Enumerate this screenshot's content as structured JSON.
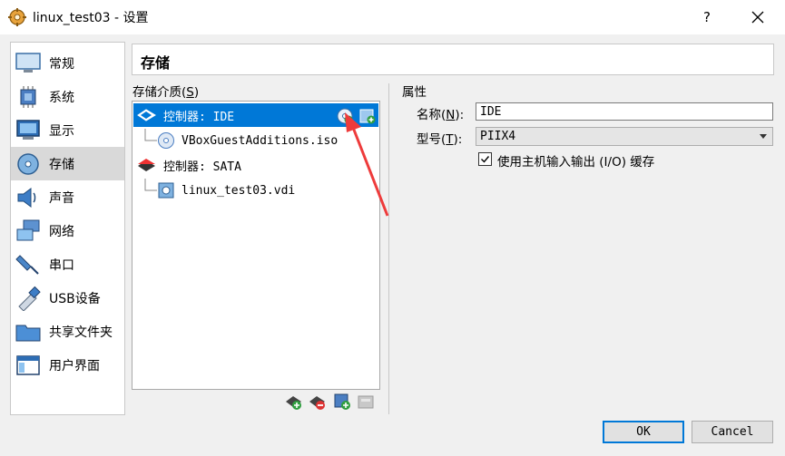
{
  "window": {
    "title": "linux_test03 - 设置",
    "help_label": "?"
  },
  "sidebar": {
    "items": [
      {
        "label": "常规",
        "icon": "monitor-icon"
      },
      {
        "label": "系统",
        "icon": "chip-icon"
      },
      {
        "label": "显示",
        "icon": "display-icon"
      },
      {
        "label": "存储",
        "icon": "disk-icon",
        "selected": true
      },
      {
        "label": "声音",
        "icon": "speaker-icon"
      },
      {
        "label": "网络",
        "icon": "network-icon"
      },
      {
        "label": "串口",
        "icon": "serial-port-icon"
      },
      {
        "label": "USB设备",
        "icon": "usb-icon"
      },
      {
        "label": "共享文件夹",
        "icon": "folder-icon"
      },
      {
        "label": "用户界面",
        "icon": "window-icon"
      }
    ]
  },
  "header": {
    "title": "存储"
  },
  "storage": {
    "group_label": "存储介质(",
    "group_mnemonic": "S",
    "group_label_end": ")",
    "tree": [
      {
        "label": "控制器: IDE",
        "type": "controller",
        "selected": true
      },
      {
        "label": "VBoxGuestAdditions.iso",
        "type": "optical"
      },
      {
        "label": "控制器: SATA",
        "type": "controller"
      },
      {
        "label": "linux_test03.vdi",
        "type": "harddisk"
      }
    ]
  },
  "attributes": {
    "group_label": "属性",
    "name_label": "名称(",
    "name_mnemonic": "N",
    "name_label_end": "):",
    "name_value": "IDE",
    "type_label": "型号(",
    "type_mnemonic": "T",
    "type_label_end": "):",
    "type_value": "PIIX4",
    "cache_label": "使用主机输入输出 (I/O) 缓存",
    "cache_checked": true
  },
  "buttons": {
    "ok": "OK",
    "cancel": "Cancel"
  },
  "colors": {
    "selection": "#0078d7",
    "annotation_arrow": "#ee3b3b"
  }
}
